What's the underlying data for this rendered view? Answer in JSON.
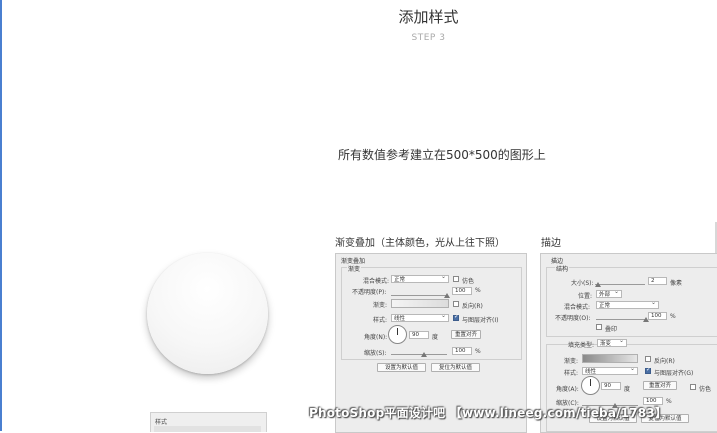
{
  "header": {
    "title": "添加样式",
    "step": "STEP 3"
  },
  "note": "所有数值参考建立在500*500的图形上",
  "sections": {
    "gradient_overlay_label": "渐变叠加（主体颜色，光从上往下照）",
    "stroke_label": "描边"
  },
  "style_panel": {
    "label": "样式"
  },
  "gradient_panel": {
    "title": "渐变叠加",
    "group": "渐变",
    "blend_mode_label": "混合模式:",
    "blend_mode_value": "正常",
    "dither_label": "仿色",
    "opacity_label": "不透明度(P):",
    "opacity_value": "100",
    "opacity_unit": "%",
    "gradient_label": "渐变:",
    "reverse_label": "反向(R)",
    "style_label": "样式:",
    "style_value": "线性",
    "align_label": "与图层对齐(I)",
    "angle_label": "角度(N):",
    "angle_value": "90",
    "angle_unit": "度",
    "reset_align_button": "重置对齐",
    "scale_label": "缩放(S):",
    "scale_value": "100",
    "scale_unit": "%",
    "set_default_button": "设置为默认值",
    "reset_default_button": "复位为默认值"
  },
  "stroke_panel": {
    "title": "描边",
    "group": "结构",
    "size_label": "大小(S):",
    "size_value": "2",
    "size_unit": "像素",
    "position_label": "位置:",
    "position_value": "外部",
    "blend_mode_label": "混合模式:",
    "blend_mode_value": "正常",
    "opacity_label": "不透明度(O):",
    "opacity_value": "100",
    "opacity_unit": "%",
    "overprint_label": "叠印",
    "fill_type_label": "填充类型:",
    "fill_type_value": "渐变",
    "gradient_label": "渐变:",
    "reverse_label": "反向(R)",
    "style_label": "样式:",
    "style_value": "线性",
    "align_label": "与图层对齐(G)",
    "angle_label": "角度(A):",
    "angle_value": "90",
    "angle_unit": "度",
    "reset_align_button": "重置对齐",
    "dither_label": "仿色",
    "scale_label": "缩放(C):",
    "scale_value": "100",
    "scale_unit": "%",
    "set_default_button": "设置为默认值",
    "reset_default_button": "复位为默认值"
  },
  "watermark": "PhotoShop平面设计吧 【www.lineeg.com/tieba/1783】",
  "colors": {
    "accent_line": "#4a7fd0",
    "panel_bg": "#ededed",
    "checkbox_on": "#4a6fa5"
  }
}
